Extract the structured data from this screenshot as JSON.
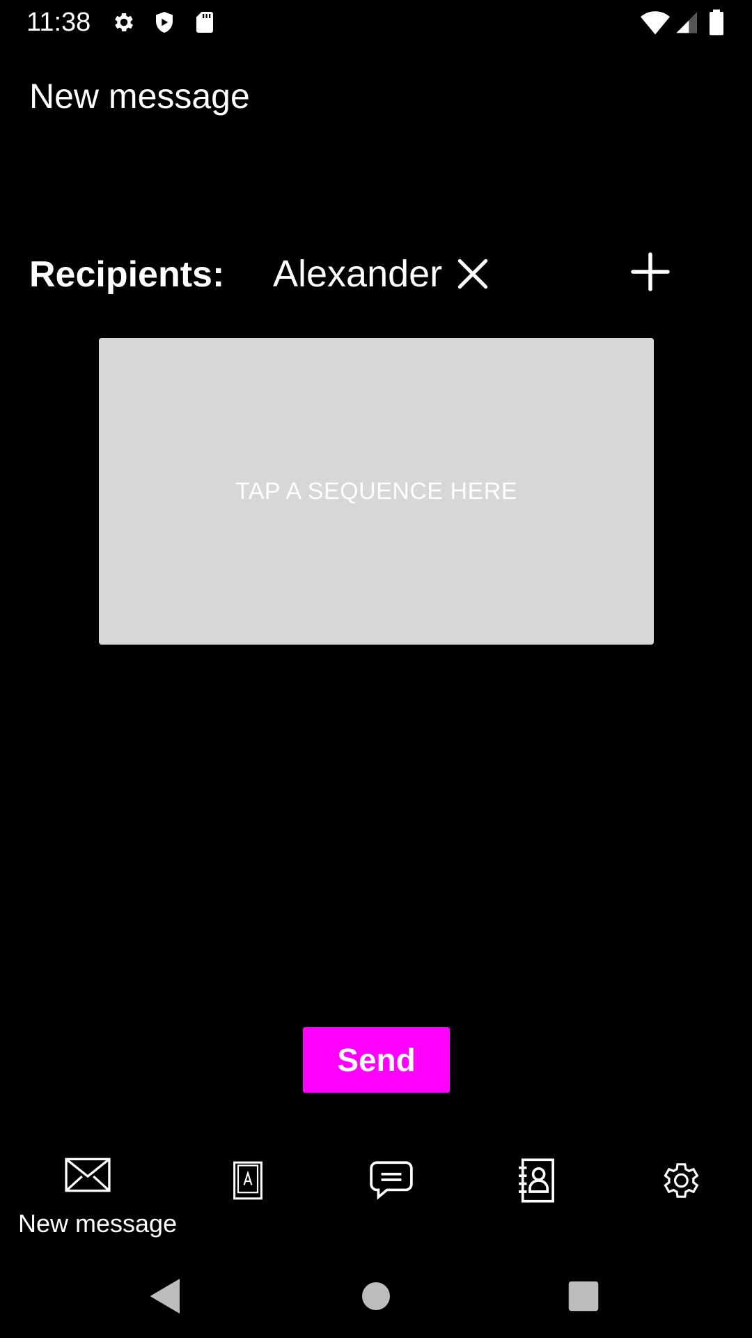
{
  "status_bar": {
    "time": "11:38",
    "left_icons": [
      "gear-icon",
      "shield-icon",
      "sd-card-icon"
    ],
    "right_icons": [
      "wifi-icon",
      "cellular-signal-icon",
      "battery-icon"
    ]
  },
  "header": {
    "title": "New message"
  },
  "recipients": {
    "label": "Recipients:",
    "chips": [
      {
        "name": "Alexander"
      }
    ]
  },
  "sequence_area": {
    "placeholder": "TAP A SEQUENCE HERE"
  },
  "send_button": {
    "label": "Send"
  },
  "bottom_nav": {
    "items": [
      {
        "icon": "envelope-icon",
        "label": "New message",
        "selected": true
      },
      {
        "icon": "alphabet-book-icon",
        "label": ""
      },
      {
        "icon": "chat-bubble-icon",
        "label": ""
      },
      {
        "icon": "contacts-book-icon",
        "label": ""
      },
      {
        "icon": "settings-gear-icon",
        "label": ""
      }
    ]
  },
  "system_nav": {
    "buttons": [
      "back-icon",
      "home-icon",
      "recents-icon"
    ]
  },
  "colors": {
    "background": "#000000",
    "accent": "#ff00ff",
    "sequence_area_bg": "#d6d7d7",
    "text": "#ffffff"
  }
}
